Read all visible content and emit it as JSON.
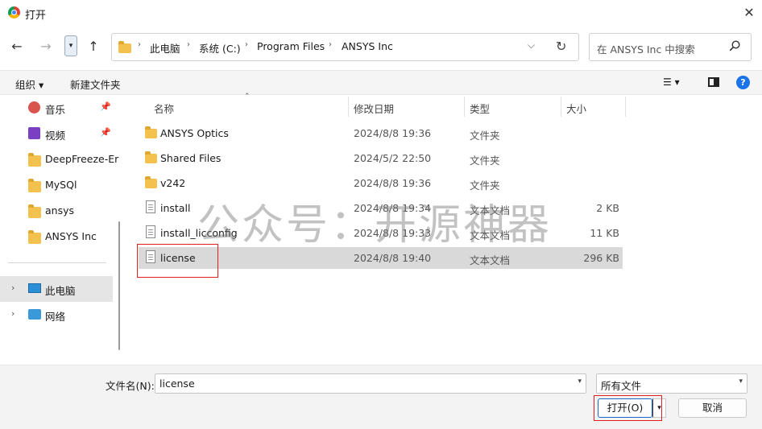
{
  "window": {
    "title": "打开",
    "close_glyph": "✕"
  },
  "nav": {
    "back_glyph": "←",
    "forward_glyph": "→",
    "dropdown_glyph": "▾",
    "up_glyph": "↑",
    "breadcrumbs": [
      "此电脑",
      "系统 (C:)",
      "Program Files",
      "ANSYS Inc"
    ],
    "crumb_separator": "›",
    "address_chevron": "⌵",
    "refresh_glyph": "↻",
    "search_placeholder": "在 ANSYS Inc 中搜索"
  },
  "toolbar": {
    "organize": "组织 ▾",
    "new_folder": "新建文件夹",
    "view_glyph": "☰ ▾",
    "help_glyph": "?"
  },
  "sidebar": {
    "items": [
      {
        "label": "音乐",
        "icon": "music-icon",
        "pinned": true
      },
      {
        "label": "视频",
        "icon": "video-icon",
        "pinned": true
      },
      {
        "label": "DeepFreeze-Er",
        "icon": "folder-icon",
        "pinned": false
      },
      {
        "label": "MySQl",
        "icon": "folder-icon",
        "pinned": false
      },
      {
        "label": "ansys",
        "icon": "folder-icon",
        "pinned": false
      },
      {
        "label": "ANSYS Inc",
        "icon": "folder-icon",
        "pinned": false
      }
    ],
    "tree": [
      {
        "label": "此电脑",
        "icon": "computer-icon",
        "selected": true
      },
      {
        "label": "网络",
        "icon": "network-icon",
        "selected": false
      }
    ],
    "pin_glyph": "📌",
    "expand_glyph": "›"
  },
  "columns": {
    "name": "名称",
    "date": "修改日期",
    "type": "类型",
    "size": "大小",
    "sort_glyph": "⌃"
  },
  "files": [
    {
      "name": "ANSYS Optics",
      "date": "2024/8/8 19:36",
      "type": "文件夹",
      "size": "",
      "kind": "folder"
    },
    {
      "name": "Shared Files",
      "date": "2024/5/2 22:50",
      "type": "文件夹",
      "size": "",
      "kind": "folder"
    },
    {
      "name": "v242",
      "date": "2024/8/8 19:36",
      "type": "文件夹",
      "size": "",
      "kind": "folder"
    },
    {
      "name": "install",
      "date": "2024/8/8 19:34",
      "type": "文本文档",
      "size": "2 KB",
      "kind": "doc"
    },
    {
      "name": "install_licconfig",
      "date": "2024/8/8 19:33",
      "type": "文本文档",
      "size": "11 KB",
      "kind": "doc"
    },
    {
      "name": "license",
      "date": "2024/8/8 19:40",
      "type": "文本文档",
      "size": "296 KB",
      "kind": "doc",
      "selected": true
    }
  ],
  "watermark": "公众号：开源神器",
  "bottom": {
    "filename_label": "文件名(N):",
    "filename_value": "license",
    "filter_value": "所有文件",
    "open_label": "打开(O)",
    "cancel_label": "取消",
    "dropdown_glyph": "▾",
    "split_glyph": "▾"
  },
  "colors": {
    "accent": "#1a73e8",
    "highlight_box": "#e02020",
    "folder": "#f2c14e",
    "selection": "#d9d9d9"
  }
}
